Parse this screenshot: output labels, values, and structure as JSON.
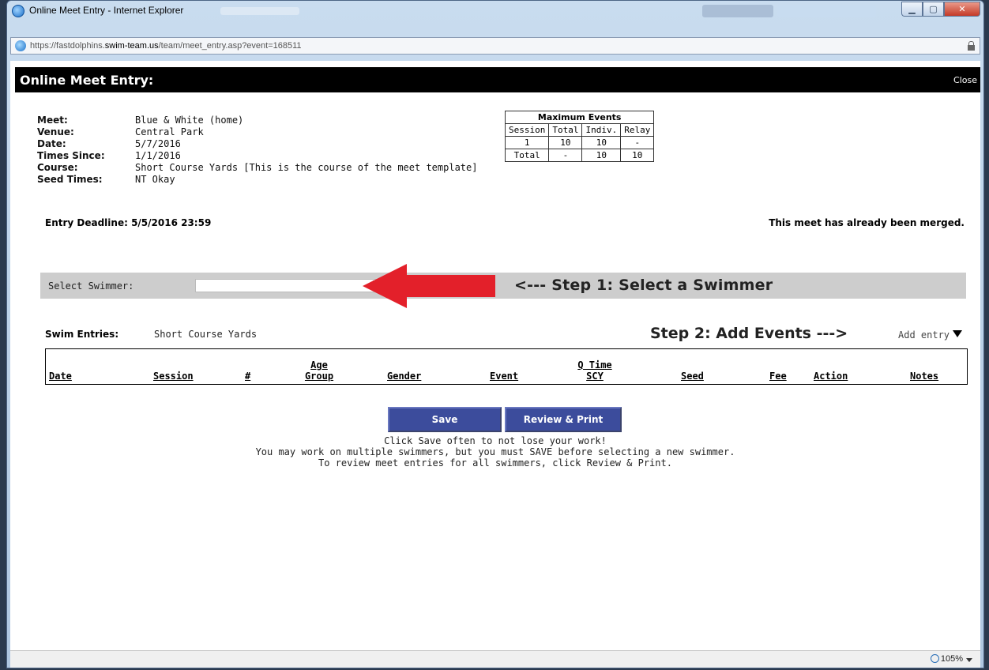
{
  "window": {
    "title": "Online Meet Entry - Internet Explorer",
    "url_prefix": "https://fastdolphins.",
    "url_domain": "swim-team.us",
    "url_path": "/team/meet_entry.asp?event=168511",
    "zoom": "105%"
  },
  "header": {
    "title": "Online Meet Entry:",
    "close_label": "Close"
  },
  "meet_info": [
    {
      "label": "Meet:",
      "value": "Blue & White (home)"
    },
    {
      "label": "Venue:",
      "value": "Central Park"
    },
    {
      "label": "Date:",
      "value": "5/7/2016"
    },
    {
      "label": "Times Since:",
      "value": "1/1/2016"
    },
    {
      "label": "Course:",
      "value": "Short Course Yards [This is the course of the meet template]"
    },
    {
      "label": "Seed Times:",
      "value": "NT Okay"
    }
  ],
  "max_events": {
    "title": "Maximum Events",
    "headers": [
      "Session",
      "Total",
      "Indiv.",
      "Relay"
    ],
    "rows": [
      [
        "1",
        "10",
        "10",
        "-"
      ],
      [
        "Total",
        "-",
        "10",
        "10"
      ]
    ]
  },
  "deadline": "Entry Deadline: 5/5/2016 23:59",
  "merged_notice": "This meet has already been merged.",
  "select_swimmer": {
    "label": "Select Swimmer:",
    "value": ""
  },
  "step1": "<--- Step 1: Select a Swimmer",
  "entries": {
    "label": "Swim Entries:",
    "course": "Short Course Yards",
    "step2": "Step 2: Add Events --->",
    "add_entry": "Add entry",
    "columns": {
      "date": "Date",
      "session": "Session",
      "number": "#",
      "age_top": "Age",
      "age_bottom": "Group",
      "gender": "Gender",
      "event": "Event",
      "qtime_top": "Q Time",
      "qtime_bottom": "SCY",
      "seed": "Seed",
      "fee": "Fee",
      "action": "Action",
      "notes": "Notes"
    }
  },
  "buttons": {
    "save": "Save",
    "review": "Review & Print"
  },
  "help": [
    "Click Save often to not lose your work!",
    "You may work on multiple swimmers, but you must SAVE before selecting a new swimmer.",
    "To review meet entries for all swimmers, click Review & Print."
  ],
  "colors": {
    "header_bg": "#000000",
    "button_bg": "#3c4c9c",
    "arrow": "#e3202a",
    "select_bar": "#cdcdcd"
  }
}
